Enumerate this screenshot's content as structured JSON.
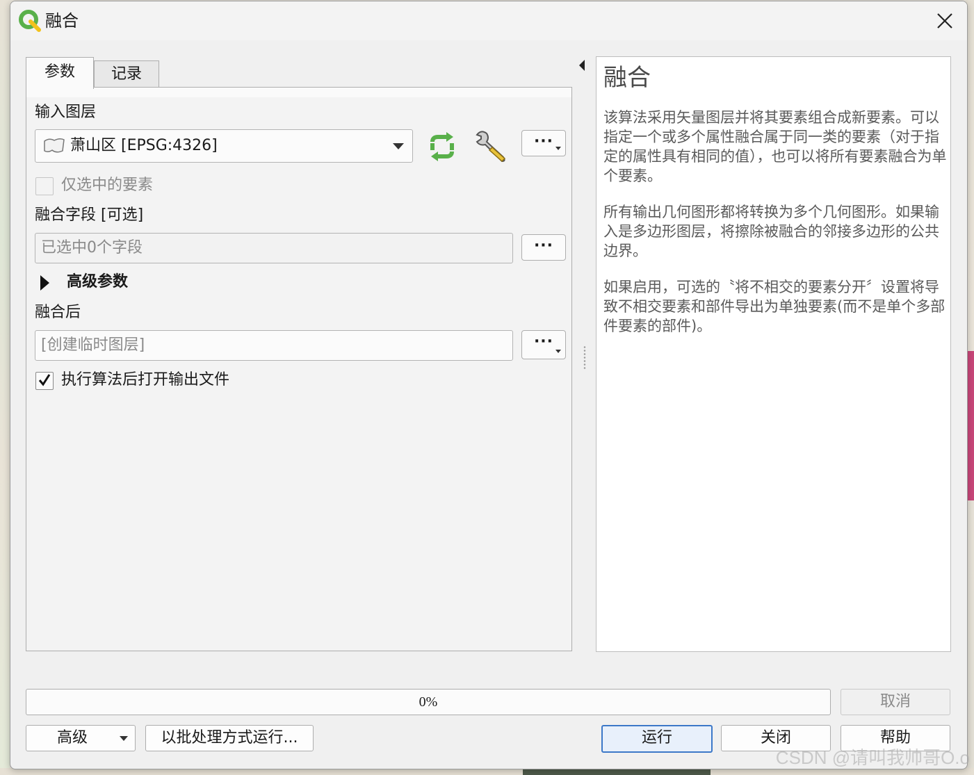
{
  "window": {
    "title": "融合"
  },
  "tabs": [
    {
      "label": "参数",
      "active": true
    },
    {
      "label": "记录",
      "active": false
    }
  ],
  "params": {
    "input_layer_label": "输入图层",
    "input_layer_value": "萧山区 [EPSG:4326]",
    "selected_only_label": "仅选中的要素",
    "selected_only_checked": false,
    "dissolve_field_label": "融合字段 [可选]",
    "dissolve_field_placeholder": "已选中0个字段",
    "advanced_label": "高级参数",
    "output_label": "融合后",
    "output_placeholder": "[创建临时图层]",
    "open_after_label": "执行算法后打开输出文件",
    "open_after_checked": true,
    "dots": "···"
  },
  "help": {
    "title": "融合",
    "paragraphs": [
      "该算法采用矢量图层并将其要素组合成新要素。可以指定一个或多个属性融合属于同一类的要素（对于指定的属性具有相同的值），也可以将所有要素融合为单个要素。",
      "所有输出几何图形都将转换为多个几何图形。如果输入是多边形图层，将擦除被融合的邻接多边形的公共边界。",
      "如果启用，可选的〝将不相交的要素分开〞设置将导致不相交要素和部件导出为单独要素(而不是单个多部件要素的部件)。"
    ]
  },
  "progress": {
    "text": "0%",
    "fraction": 0.0
  },
  "buttons": {
    "cancel": "取消",
    "advanced": "高级",
    "batch": "以批处理方式运行...",
    "run": "运行",
    "close": "关闭",
    "help": "帮助"
  },
  "watermark": "CSDN @请叫我帅哥O.o",
  "icons": {
    "app": "qgis-logo-icon",
    "refresh": "iterate-refresh-icon",
    "wrench": "wrench-icon",
    "polygon": "polygon-layer-icon"
  },
  "colors": {
    "accent": "#3c78c8",
    "refresh_green": "#59b04a",
    "map_polygon": "#c9477a"
  }
}
